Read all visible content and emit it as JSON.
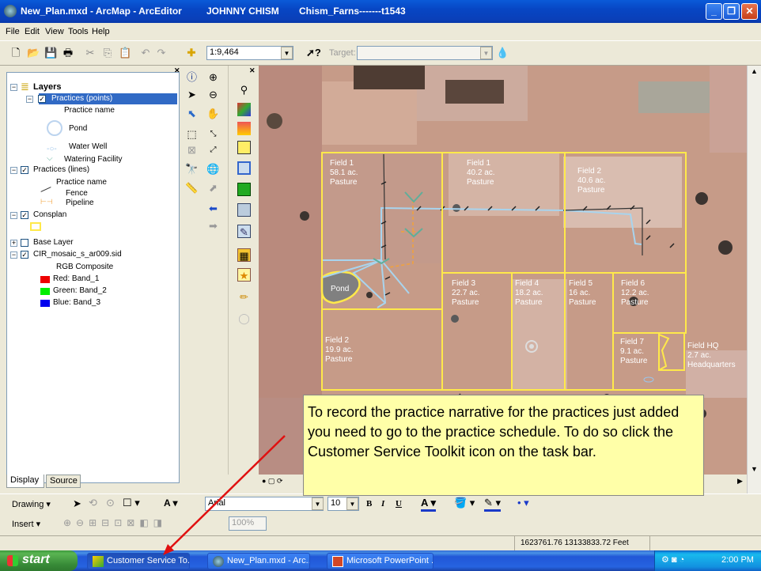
{
  "window": {
    "title": "New_Plan.mxd - ArcMap - ArcEditor",
    "user": "JOHNNY CHISM",
    "farm": "Chism_Farns-------t1543",
    "min": "_",
    "max": "❐",
    "close": "✕"
  },
  "menu": [
    "File",
    "Edit",
    "View",
    "Tools",
    "Help"
  ],
  "toolbar": {
    "scale": "1:9,464",
    "target_label": "Target:",
    "target_value": ""
  },
  "toc": {
    "root": "Layers",
    "practices_points": "Practices (points)",
    "practice_name_1": "Practice name",
    "pond": "Pond",
    "water_well": "Water Well",
    "watering_facility": "Watering Facility",
    "practices_lines": "Practices (lines)",
    "practice_name_2": "Practice name",
    "fence": "Fence",
    "pipeline": "Pipeline",
    "consplan": "Consplan",
    "base_layer": "Base Layer",
    "cir": "CIR_mosaic_s_ar009.sid",
    "rgb": "RGB Composite",
    "red": "Red:   Band_1",
    "green": "Green:  Band_2",
    "blue": "Blue:  Band_3",
    "tab_display": "Display",
    "tab_source": "Source"
  },
  "map": {
    "fields": [
      {
        "name": "Field  1",
        "acres": "58.1 ac.",
        "use": "Pasture"
      },
      {
        "name": "Field  1",
        "acres": "40.2 ac.",
        "use": "Pasture"
      },
      {
        "name": "Field  2",
        "acres": "40.6 ac.",
        "use": "Pasture"
      },
      {
        "name": "Field  3",
        "acres": "22.7 ac.",
        "use": "Pasture"
      },
      {
        "name": "Field  4",
        "acres": "18.2 ac.",
        "use": "Pasture"
      },
      {
        "name": "Field  5",
        "acres": "16 ac.",
        "use": "Pasture"
      },
      {
        "name": "Field  6",
        "acres": "12.2 ac.",
        "use": "Pasture"
      },
      {
        "name": "Field  2",
        "acres": "19.9 ac.",
        "use": "Pasture"
      },
      {
        "name": "Field  7",
        "acres": "9.1 ac.",
        "use": "Pasture"
      },
      {
        "name": "Field  HQ",
        "acres": "2.7 ac.",
        "use": "Headquarters"
      }
    ],
    "pond_label": "Pond"
  },
  "drawing": {
    "label": "Drawing ▾",
    "font": "Arial",
    "size": "10",
    "bold": "B",
    "italic": "I",
    "underline": "U"
  },
  "insert": {
    "label": "Insert ▾",
    "zoom": "100%"
  },
  "status": {
    "coords": "1623761.76  13133833.72 Feet"
  },
  "callout": {
    "text": "To record the practice narrative for the practices just added you need to go to the practice schedule. To do so click the Customer Service Toolkit icon on the task bar."
  },
  "taskbar": {
    "start": "start",
    "tasks": [
      "Customer Service To...",
      "New_Plan.mxd - Arc...",
      "Microsoft PowerPoint ..."
    ],
    "clock": "2:00 PM"
  },
  "colors": {
    "field_boundary": "#ffe94a",
    "fence": "#333333",
    "pipeline": "#f2a23a",
    "arrow": "#e01010"
  }
}
